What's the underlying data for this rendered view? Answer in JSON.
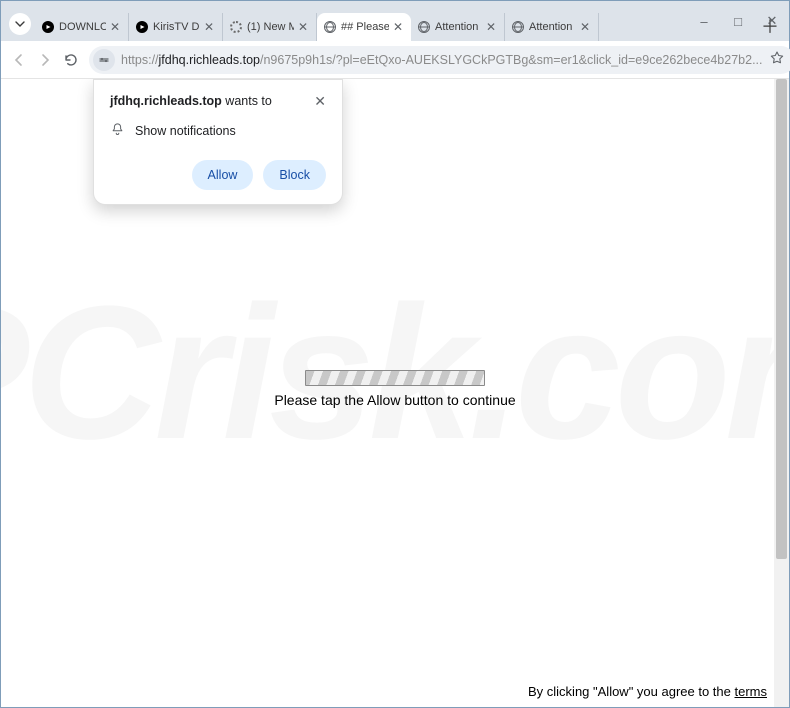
{
  "window": {
    "controls": {
      "minimize": "–",
      "maximize": "□",
      "close": "✕"
    }
  },
  "tabs": [
    {
      "title": "DOWNLO",
      "favicon": "yt",
      "active": false
    },
    {
      "title": "KirisTV Do",
      "favicon": "yt",
      "active": false
    },
    {
      "title": "(1) New M",
      "favicon": "spin",
      "active": false
    },
    {
      "title": "## Please",
      "favicon": "globe",
      "active": true
    },
    {
      "title": "Attention",
      "favicon": "globe",
      "active": false
    },
    {
      "title": "Attention",
      "favicon": "globe",
      "active": false
    }
  ],
  "tab_close_glyph": "✕",
  "newtab_glyph": "＋",
  "toolbar": {
    "back_enabled": false,
    "forward_enabled": false,
    "url_scheme": "https://",
    "url_host": "jfdhq.richleads.top",
    "url_rest": "/n9675p9h1s/?pl=eEtQxo-AUEKSLYGCkPGTBg&sm=er1&click_id=e9ce262bece4b27b2..."
  },
  "permission": {
    "site": "jfdhq.richleads.top",
    "wants_to": "wants to",
    "line": "Show notifications",
    "allow": "Allow",
    "block": "Block",
    "close_glyph": "✕"
  },
  "page": {
    "tap_message": "Please tap the Allow button to continue",
    "footer_prefix": "By clicking \"Allow\" you agree to the ",
    "footer_link": "terms"
  },
  "watermark_text": "PCrisk.com"
}
